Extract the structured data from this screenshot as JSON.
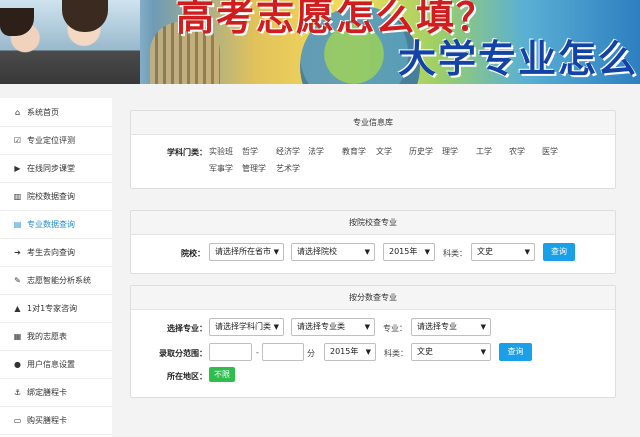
{
  "banner": {
    "title_line1": "高考志愿怎么填？",
    "title_line2": "大学专业怎么"
  },
  "sidebar": {
    "items": [
      {
        "label": "系统首页",
        "icon": "home-icon",
        "glyph": "⌂"
      },
      {
        "label": "专业定位评测",
        "icon": "check-square-icon",
        "glyph": "☑"
      },
      {
        "label": "在线同步课堂",
        "icon": "video-icon",
        "glyph": "▶"
      },
      {
        "label": "院校数据查询",
        "icon": "bank-icon",
        "glyph": "▥"
      },
      {
        "label": "专业数据查询",
        "icon": "book-icon",
        "glyph": "▤"
      },
      {
        "label": "考生去向查询",
        "icon": "arrow-right-icon",
        "glyph": "➔"
      },
      {
        "label": "志愿智能分析系统",
        "icon": "edit-icon",
        "glyph": "✎"
      },
      {
        "label": "1对1专家咨询",
        "icon": "graduation-cap-icon",
        "glyph": "▲"
      },
      {
        "label": "我的志愿表",
        "icon": "table-icon",
        "glyph": "▦"
      },
      {
        "label": "用户信息设置",
        "icon": "user-icon",
        "glyph": "●"
      },
      {
        "label": "绑定膳程卡",
        "icon": "anchor-icon",
        "glyph": "⚓"
      },
      {
        "label": "购买膳程卡",
        "icon": "card-icon",
        "glyph": "▭"
      }
    ],
    "active_index": 4,
    "active_color": "#1f8dd6"
  },
  "panel1": {
    "title": "专业信息库",
    "label": "学科门类：",
    "subjects": [
      "实验班",
      "哲学",
      "经济学",
      "法学",
      "教育学",
      "文学",
      "历史学",
      "理学",
      "工学",
      "农学",
      "医学",
      "军事学",
      "管理学",
      "艺术学"
    ]
  },
  "panel2": {
    "title": "按院校查专业",
    "label": "院校：",
    "province_select": "请选择所在省市",
    "school_select": "请选择院校",
    "year_select": "2015年",
    "kelei_label": "科类：",
    "kelei_select": "文史",
    "query_button": "查询",
    "button_color": "#1aa0e8"
  },
  "panel3": {
    "title": "按分数查专业",
    "major_label": "选择专业：",
    "category_select": "请选择学科门类",
    "class_select": "请选择专业类",
    "zhuanye_label": "专业：",
    "major_select": "请选择专业",
    "score_label": "录取分范围：",
    "dash": "-",
    "fen": "分",
    "year_select": "2015年",
    "kelei_label": "科类：",
    "kelei_select": "文史",
    "query_button": "查询",
    "region_label": "所在地区：",
    "region_button": "不限",
    "region_color": "#2fbd4d"
  }
}
